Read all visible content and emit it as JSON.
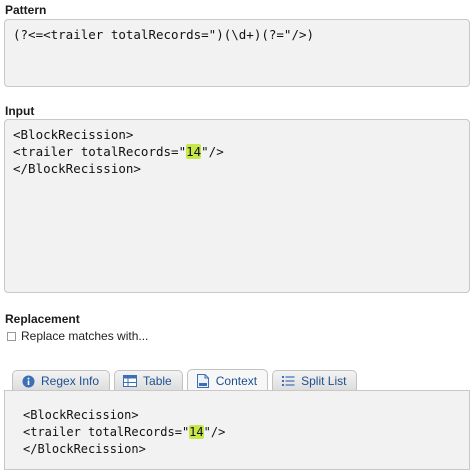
{
  "pattern": {
    "label": "Pattern",
    "value": "(?<=<trailer totalRecords=\")(\\d+)(?=\"/>)"
  },
  "input": {
    "label": "Input",
    "lines": [
      {
        "before": "<BlockRecission>",
        "match": "",
        "after": ""
      },
      {
        "before": "<trailer totalRecords=\"",
        "match": "14",
        "after": "\"/>"
      },
      {
        "before": "</BlockRecission>",
        "match": "",
        "after": ""
      }
    ]
  },
  "replacement": {
    "label": "Replacement",
    "checkbox_label": "Replace matches with...",
    "checked": false
  },
  "tabs": [
    {
      "label": "Regex Info",
      "icon": "info-icon",
      "active": false
    },
    {
      "label": "Table",
      "icon": "table-icon",
      "active": false
    },
    {
      "label": "Context",
      "icon": "document-icon",
      "active": true
    },
    {
      "label": "Split List",
      "icon": "list-icon",
      "active": false
    }
  ],
  "context": {
    "lines": [
      {
        "before": "<BlockRecission>",
        "match": "",
        "after": ""
      },
      {
        "before": "<trailer totalRecords=\"",
        "match": "14",
        "after": "\"/>"
      },
      {
        "before": "</BlockRecission>",
        "match": "",
        "after": ""
      }
    ]
  },
  "colors": {
    "match_highlight": "#c6e64a",
    "tab_text": "#1d4f91"
  }
}
